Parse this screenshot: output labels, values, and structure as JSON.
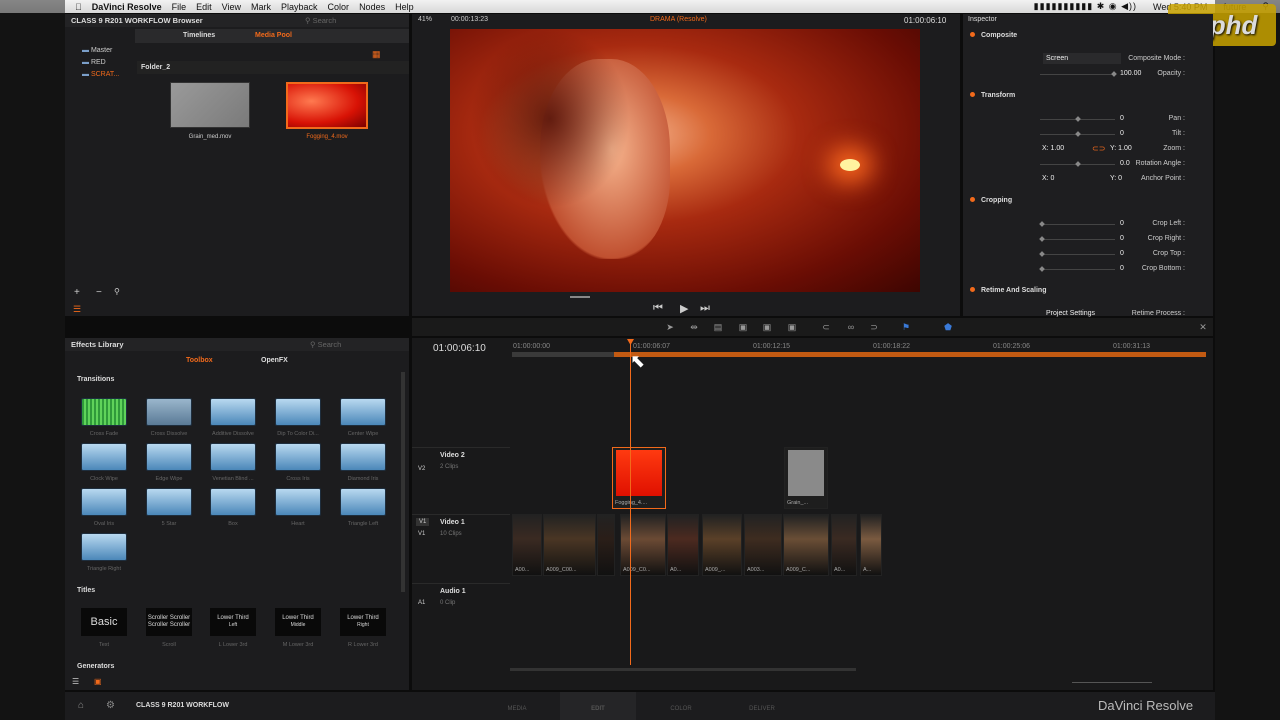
{
  "menubar": {
    "app": "DaVinci Resolve",
    "items": [
      "File",
      "Edit",
      "View",
      "Mark",
      "Playback",
      "Color",
      "Nodes",
      "Help"
    ],
    "status": "Wed 5:40 PM",
    "user": "future"
  },
  "watermark": "fxphd",
  "media": {
    "project_title": "CLASS 9 R201 WORKFLOW Browser",
    "search_placeholder": "Search",
    "tabs": [
      "Timelines",
      "Media Pool"
    ],
    "tree": [
      "Master",
      "RED",
      "SCRAT..."
    ],
    "folder": "Folder_2",
    "clips": [
      "Grain_med.mov",
      "Fogging_4.mov"
    ]
  },
  "viewer": {
    "zoom": "41%",
    "timecode_left": "00:00:13:23",
    "title": "DRAMA (Resolve)",
    "timecode_right": "01:00:06:10"
  },
  "inspector": {
    "title": "Inspector",
    "composite": {
      "header": "Composite",
      "mode_label": "Composite Mode :",
      "mode_value": "Screen",
      "opacity_label": "Opacity :",
      "opacity_value": "100.00"
    },
    "transform": {
      "header": "Transform",
      "pan_label": "Pan :",
      "pan": "0",
      "tilt_label": "Tilt :",
      "tilt": "0",
      "zoom_label": "Zoom :",
      "zoom_x": "X: 1.00",
      "zoom_y": "Y: 1.00",
      "rot_label": "Rotation Angle :",
      "rot": "0.0",
      "anchor_label": "Anchor Point :",
      "anchor_x": "X: 0",
      "anchor_y": "Y: 0"
    },
    "cropping": {
      "header": "Cropping",
      "left_label": "Crop Left :",
      "left": "0",
      "right_label": "Crop Right :",
      "right": "0",
      "top_label": "Crop Top :",
      "top": "0",
      "bottom_label": "Crop Bottom :",
      "bottom": "0"
    },
    "retime": {
      "header": "Retime And Scaling",
      "process_label": "Retime Process :",
      "process_value": "Project Settings"
    }
  },
  "effects": {
    "title": "Effects Library",
    "search_placeholder": "Search",
    "tabs": [
      "Toolbox",
      "OpenFX"
    ],
    "transitions_header": "Transitions",
    "transitions": [
      "Cross Fade",
      "Cross Dissolve",
      "Additive Dissolve",
      "Dip To Color Di...",
      "Center Wipe",
      "Clock Wipe",
      "Edge Wipe",
      "Venetian Blind ...",
      "Cross Iris",
      "Diamond Iris",
      "Oval Iris",
      "5 Star",
      "Box",
      "Heart",
      "Triangle Left",
      "Triangle Right"
    ],
    "titles_header": "Titles",
    "titles": [
      {
        "label": "Text",
        "preview": "Basic"
      },
      {
        "label": "Scroll",
        "preview": "Scroller Scroller Scroller Scroller"
      },
      {
        "label": "L Lower 3rd",
        "preview": "Lower Third",
        "sub": "Left"
      },
      {
        "label": "M Lower 3rd",
        "preview": "Lower Third",
        "sub": "Middle"
      },
      {
        "label": "R Lower 3rd",
        "preview": "Lower Third",
        "sub": "Right"
      }
    ],
    "generators_header": "Generators"
  },
  "timeline": {
    "timecode": "01:00:06:10",
    "ruler": [
      "01:00:00:00",
      "01:00:06:07",
      "01:00:12:15",
      "01:00:18:22",
      "01:00:25:06",
      "01:00:31:13"
    ],
    "tracks": [
      {
        "id": "V2",
        "name": "Video 2",
        "count": "2 Clips"
      },
      {
        "id": "V1",
        "name": "Video 1",
        "count": "10 Clips"
      },
      {
        "id": "A1",
        "name": "Audio 1",
        "count": "0 Clip"
      }
    ],
    "v2_clips": [
      "Fogging_4....",
      "Grain_..."
    ],
    "v1_clips": [
      "A00...",
      "A009_C00...",
      "A009_C0...",
      "A0...",
      "A009_...",
      "A003...",
      "A009_C...",
      "A0...",
      "A..."
    ]
  },
  "bottom": {
    "project": "CLASS 9 R201 WORKFLOW",
    "tabs": [
      "MEDIA",
      "EDIT",
      "COLOR",
      "DELIVER"
    ],
    "brand": "DaVinci Resolve"
  },
  "colors": {
    "accent": "#f26a1b",
    "panel": "#1c1c1e"
  }
}
